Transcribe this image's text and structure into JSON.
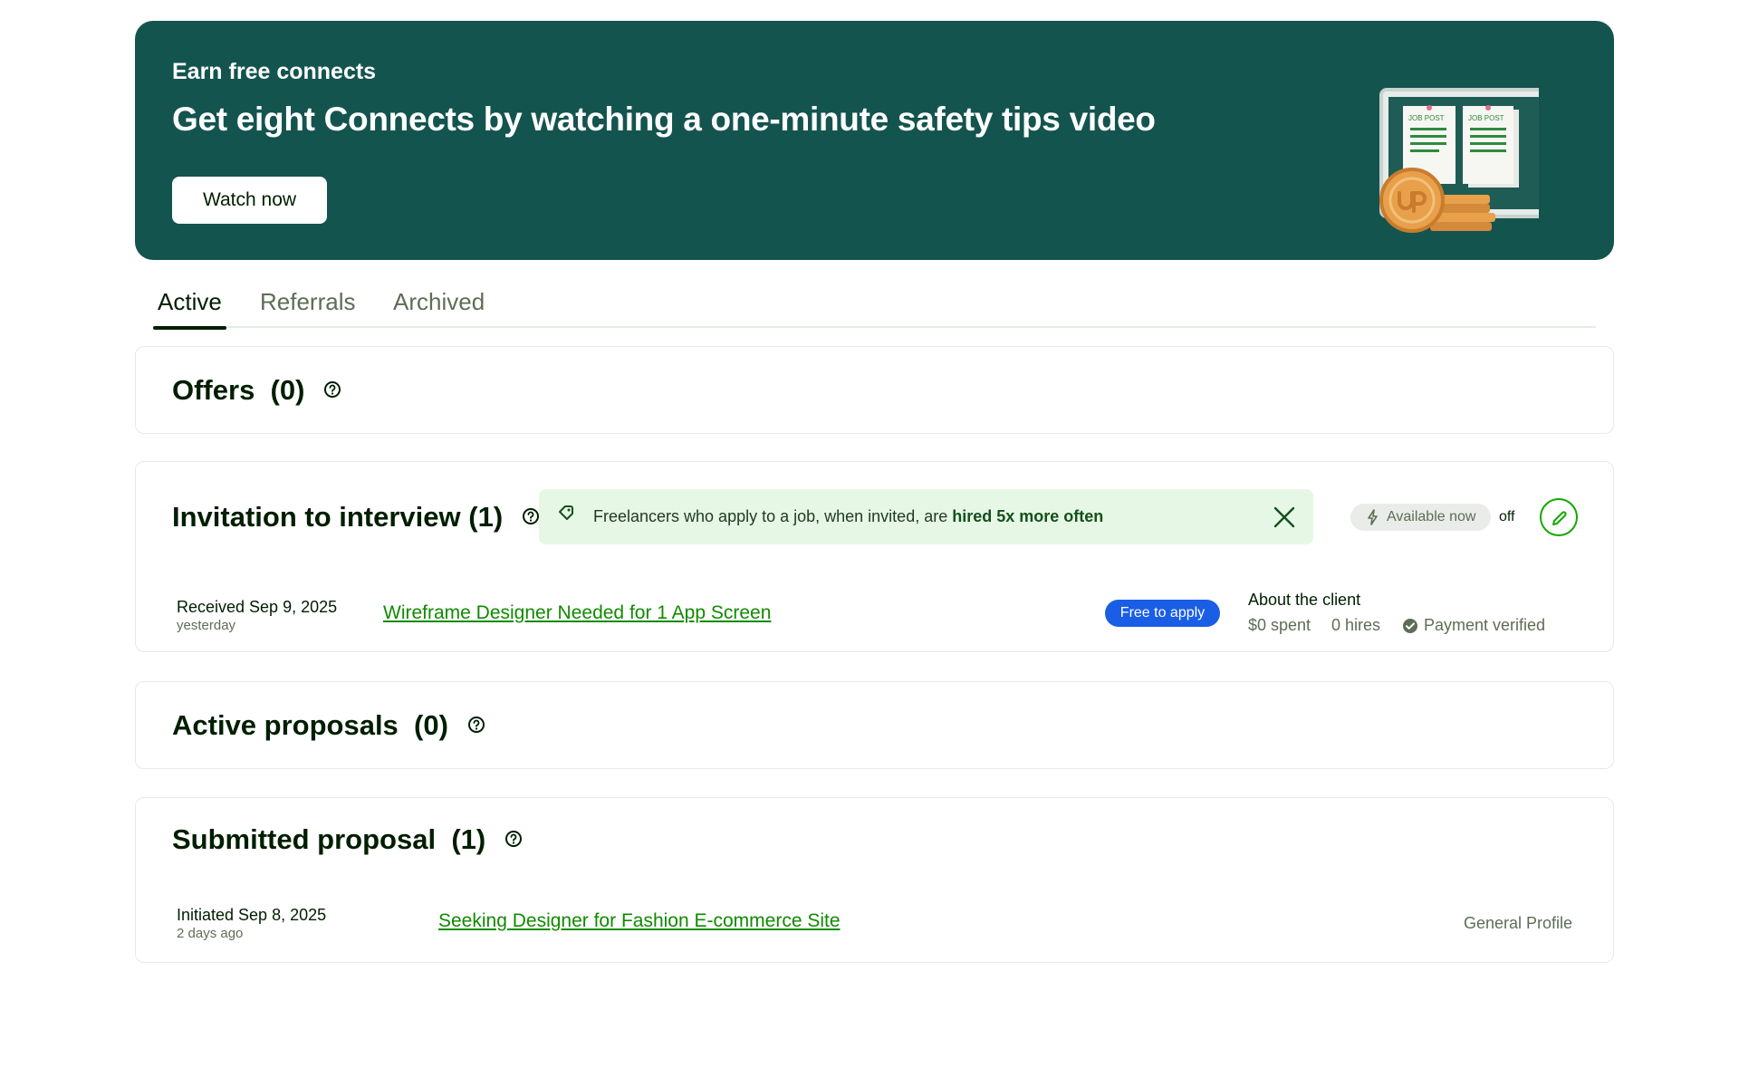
{
  "banner": {
    "eyebrow": "Earn free connects",
    "title": "Get eight Connects by watching a one-minute safety tips video",
    "cta_label": "Watch now",
    "illustration_labels": [
      "JOB POST",
      "JOB POST"
    ],
    "colors": {
      "background": "#14544f",
      "coin": "#e8a04a"
    }
  },
  "tabs": [
    {
      "label": "Active",
      "selected": true
    },
    {
      "label": "Referrals",
      "selected": false
    },
    {
      "label": "Archived",
      "selected": false
    }
  ],
  "offers": {
    "title": "Offers",
    "count": "(0)"
  },
  "invitations": {
    "title": "Invitation to interview (1)",
    "tip": {
      "text_prefix": "Freelancers who apply to a job, when invited, are ",
      "text_emphasis": "hired 5x more often"
    },
    "availability": {
      "label": "Available now",
      "state": "off"
    },
    "items": [
      {
        "received": "Received Sep 9, 2025",
        "relative": "yesterday",
        "job_title": "Wireframe Designer Needed for 1 App Screen",
        "badge": "Free to apply",
        "client": {
          "heading": "About the client",
          "spent": "$0 spent",
          "hires": "0 hires",
          "payment": "Payment verified"
        }
      }
    ]
  },
  "active_proposals": {
    "title": "Active proposals",
    "count": "(0)"
  },
  "submitted": {
    "title": "Submitted proposal",
    "count": "(1)",
    "items": [
      {
        "initiated": "Initiated Sep 8, 2025",
        "relative": "2 days ago",
        "job_title": "Seeking Designer for Fashion E-commerce Site",
        "profile": "General Profile"
      }
    ]
  },
  "colors": {
    "accent_green": "#108a00",
    "badge_blue": "#1a5ee6",
    "tip_bg": "#e7f7e6"
  }
}
